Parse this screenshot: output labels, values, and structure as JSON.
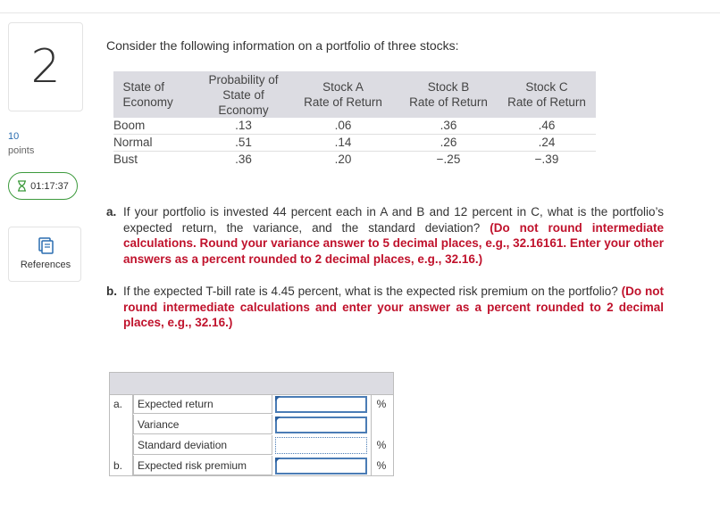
{
  "question": {
    "number": "2",
    "points_value": "10",
    "points_label": "points",
    "timer": "01:17:37",
    "references_label": "References"
  },
  "intro": "Consider the following information on a portfolio of three stocks:",
  "table": {
    "headers": {
      "state": "State of Economy",
      "probability": "Probability of State of Economy",
      "stock_a_name": "Stock A",
      "stock_a_sub": "Rate of Return",
      "stock_b_name": "Stock B",
      "stock_b_sub": "Rate of Return",
      "stock_c_name": "Stock C",
      "stock_c_sub": "Rate of Return"
    },
    "rows": [
      {
        "state": "Boom",
        "prob": ".13",
        "a": ".06",
        "b": ".36",
        "c": ".46"
      },
      {
        "state": "Normal",
        "prob": ".51",
        "a": ".14",
        "b": ".26",
        "c": ".24"
      },
      {
        "state": "Bust",
        "prob": ".36",
        "a": ".20",
        "b": "−.25",
        "c": "−.39"
      }
    ]
  },
  "part_a": {
    "label": "a.",
    "text": "If your portfolio is invested 44 percent each in A and B and 12 percent in C, what is the portfolio’s expected return, the variance, and the standard deviation?",
    "instruction": "(Do not round intermediate calculations. Round your variance answer to 5 decimal places, e.g., 32.16161. Enter your other answers as a percent rounded to 2 decimal places, e.g., 32.16.)"
  },
  "part_b": {
    "label": "b.",
    "text": "If the expected T-bill rate is 4.45 percent, what is the expected risk premium on the portfolio?",
    "instruction": "(Do not round intermediate calculations and enter your answer as a percent rounded to 2 decimal places, e.g., 32.16.)"
  },
  "answers": [
    {
      "letter": "a.",
      "label": "Expected return",
      "value": "",
      "unit": "%"
    },
    {
      "letter": "",
      "label": "Variance",
      "value": "",
      "unit": ""
    },
    {
      "letter": "",
      "label": "Standard deviation",
      "value": "",
      "unit": "%"
    },
    {
      "letter": "b.",
      "label": "Expected risk premium",
      "value": "",
      "unit": "%"
    }
  ],
  "colors": {
    "accent": "#2a6db0",
    "instruction_red": "#c0122c",
    "timer_green": "#3c9a3c",
    "header_gray": "#dcdce2"
  }
}
